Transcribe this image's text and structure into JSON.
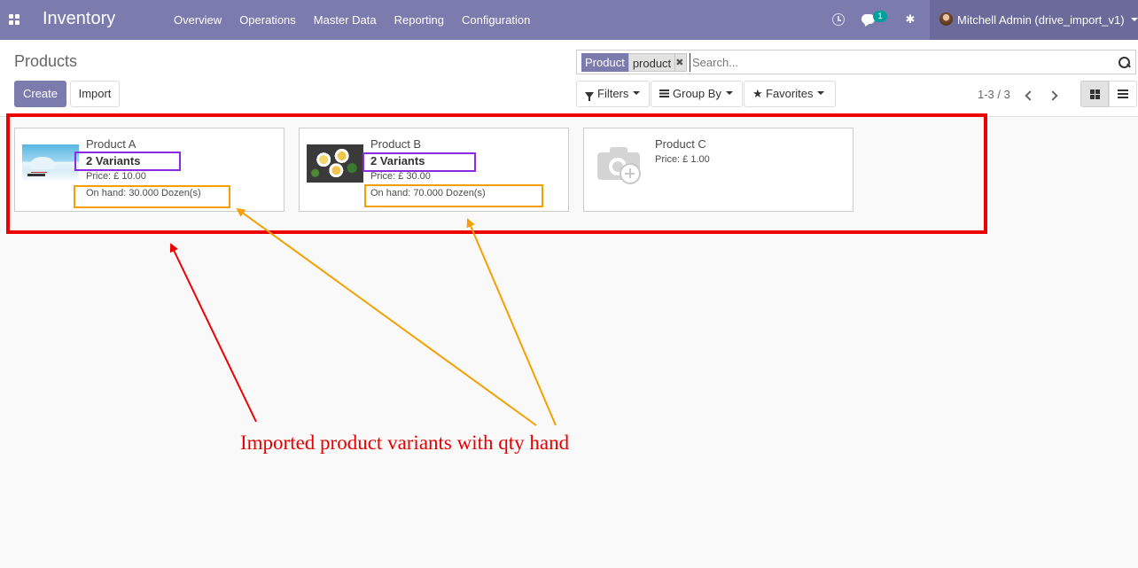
{
  "navbar": {
    "brand": "Inventory",
    "menu": [
      "Overview",
      "Operations",
      "Master Data",
      "Reporting",
      "Configuration"
    ],
    "chat_badge": "1",
    "user": "Mitchell Admin (drive_import_v1)",
    "color": "#7c7bad"
  },
  "control_panel": {
    "breadcrumb": "Products",
    "create_label": "Create",
    "import_label": "Import",
    "search": {
      "facet_label": "Product",
      "facet_value": "product",
      "placeholder": "Search..."
    },
    "filters_label": "Filters",
    "groupby_label": "Group By",
    "favorites_label": "Favorites",
    "pager": "1-3 / 3",
    "active_view": "kanban"
  },
  "products": [
    {
      "name": "Product A",
      "variants": "2 Variants",
      "price": "Price: £ 10.00",
      "on_hand": "On hand: 30.000 Dozen(s)",
      "image": "winter-landscape"
    },
    {
      "name": "Product B",
      "variants": "2 Variants",
      "price": "Price: £ 30.00",
      "on_hand": "On hand: 70.000 Dozen(s)",
      "image": "food-dish"
    },
    {
      "name": "Product C",
      "price": "Price: £ 1.00",
      "image": "camera-placeholder-icon"
    }
  ],
  "annotation": {
    "caption": "Imported product variants with qty hand",
    "colors": {
      "red": "#ee0000",
      "purple": "#8a2be2",
      "orange": "#f5a000"
    }
  }
}
